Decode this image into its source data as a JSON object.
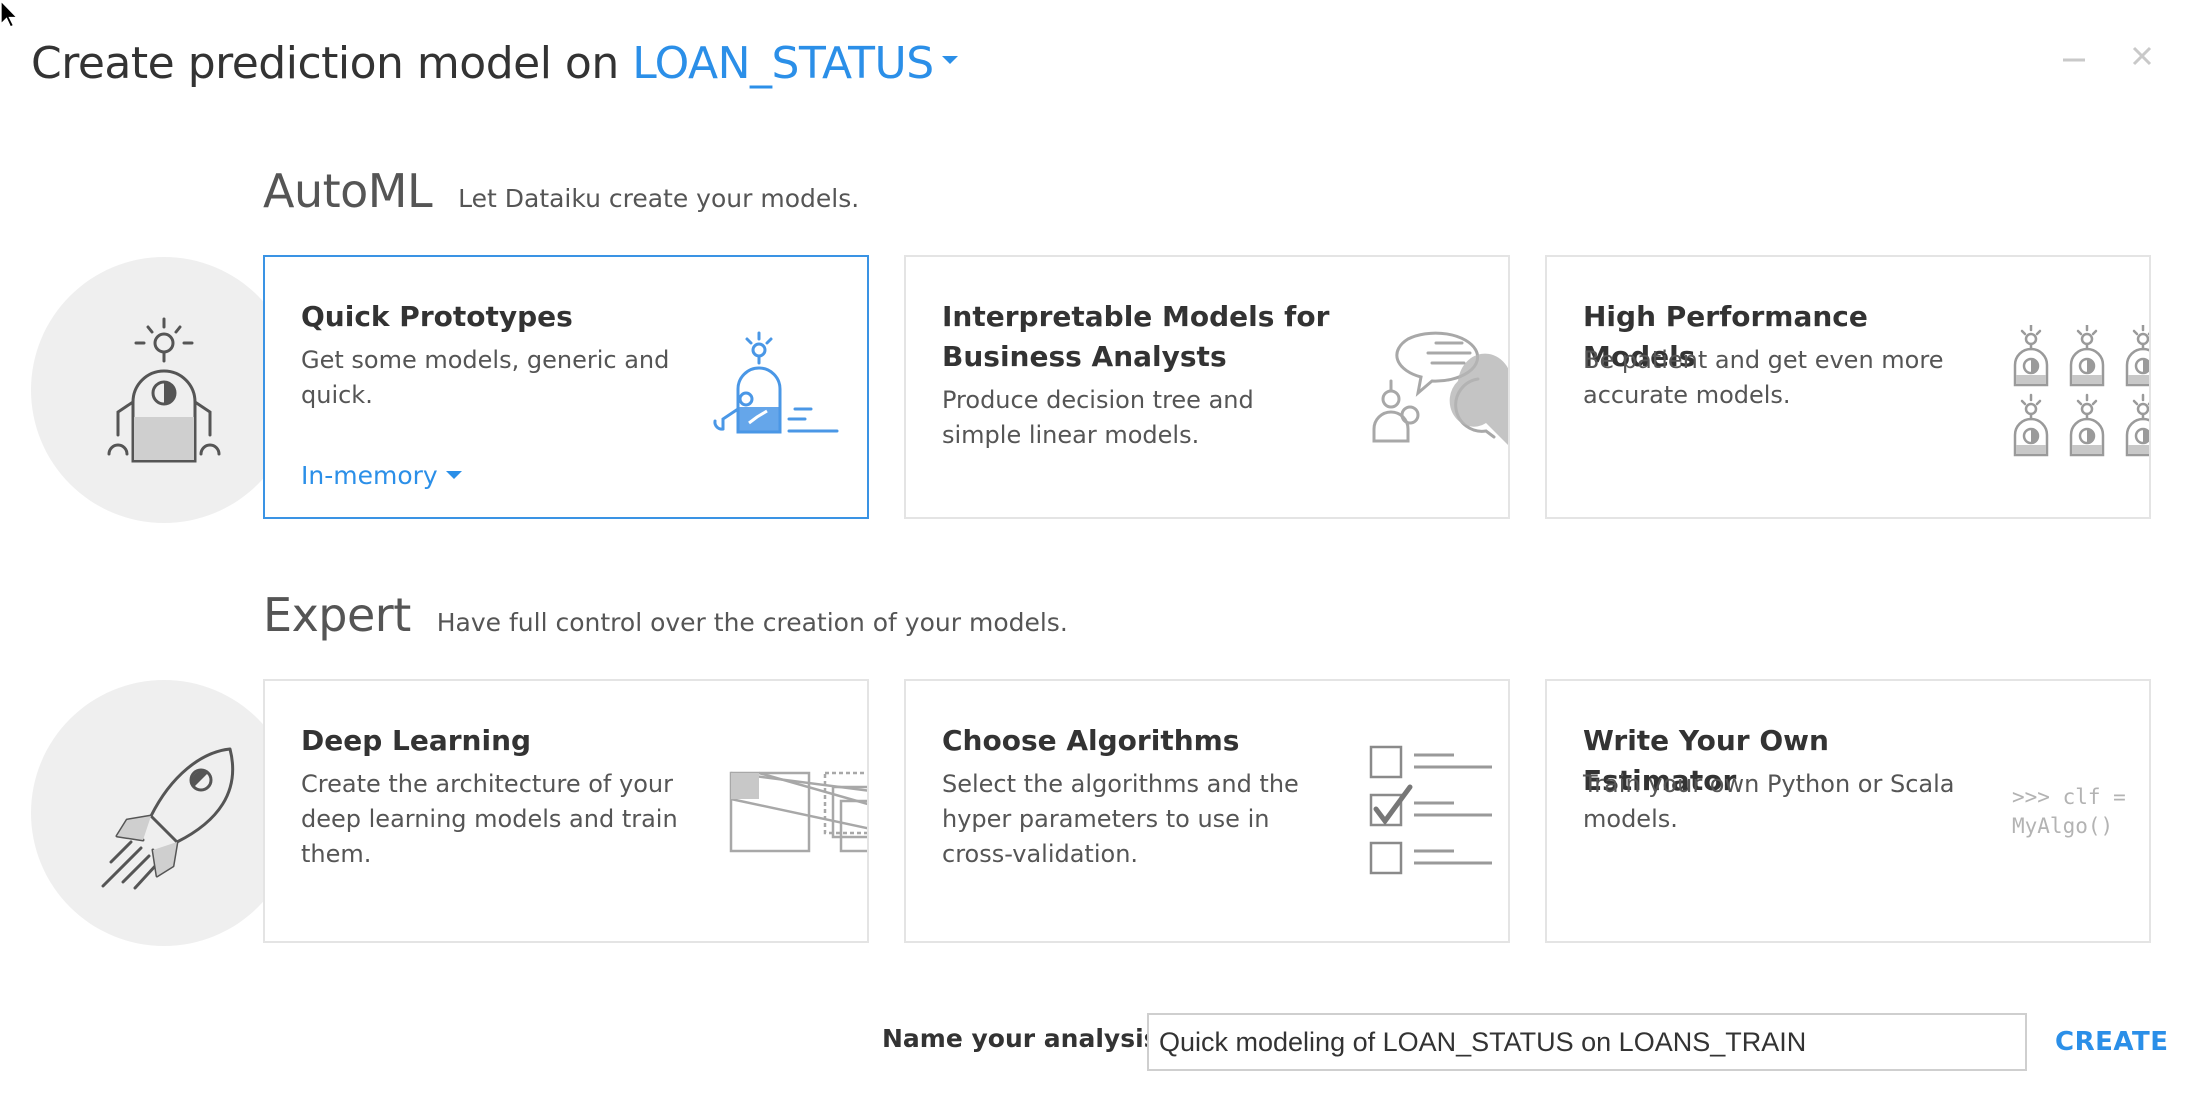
{
  "dialog": {
    "title_prefix": "Create prediction model on",
    "target_variable": "LOAN_STATUS",
    "minimize_glyph": "–",
    "close_glyph": "×"
  },
  "automl": {
    "heading": "AutoML",
    "subheading": "Let Dataiku create your models.",
    "cards": [
      {
        "title": "Quick Prototypes",
        "description": "Get some models, generic and quick.",
        "engine_label": "In-memory",
        "icon": "robot-prototype-icon",
        "selected": true
      },
      {
        "title": "Interpretable Models for Business Analysts",
        "description": "Produce decision tree and simple linear models.",
        "icon": "conversation-icon"
      },
      {
        "title": "High Performance Models",
        "description": "Be patient and get even more accurate models.",
        "icon": "robot-grid-icon"
      }
    ]
  },
  "expert": {
    "heading": "Expert",
    "subheading": "Have full control over the creation of your models.",
    "cards": [
      {
        "title": "Deep Learning",
        "description": "Create the architecture of your deep learning models and train them.",
        "icon": "layers-icon"
      },
      {
        "title": "Choose Algorithms",
        "description": "Select the algorithms and the hyper parameters to use in cross-validation.",
        "icon": "checklist-icon"
      },
      {
        "title": "Write Your Own Estimator",
        "description": "Train your own Python or Scala models.",
        "code_snippet": ">>> clf =\nMyAlgo()",
        "icon": "code-icon"
      }
    ]
  },
  "footer": {
    "name_label": "Name your analysis",
    "name_value": "Quick modeling of LOAN_STATUS on LOANS_TRAIN",
    "create_label": "CREATE"
  },
  "colors": {
    "accent": "#2b8fe8",
    "card_border": "#e4e4e4",
    "selected_border": "#3a93e4",
    "circle_bg": "#efefef"
  }
}
